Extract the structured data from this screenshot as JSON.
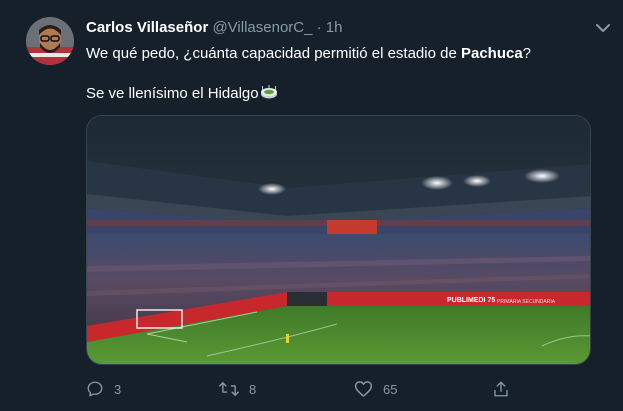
{
  "tweet": {
    "author_name": "Carlos Villaseñor",
    "author_handle": "@VillasenorC_",
    "separator": "·",
    "time": "1h",
    "text_part1": "We qué pedo, ¿cuánta capacidad permitió el estadio de ",
    "text_bold": "Pachuca",
    "text_part2": "?",
    "text_line2": "Se ve llenísimo el Hidalgo",
    "emoji_icon": "stadium-emoji-icon",
    "image_board_text": "PUBLIMEDI 75",
    "image_board_sub": "PRIMARIA SECUNDARIA"
  },
  "actions": {
    "replies": "3",
    "retweets": "8",
    "likes": "65"
  },
  "colors": {
    "background": "#15202b",
    "secondary_text": "#8899a6",
    "border": "#38444d",
    "pitch": "#4f8a2e",
    "ad_board": "#c8282c"
  },
  "icons": [
    "more-options-icon",
    "reply-icon",
    "retweet-icon",
    "like-icon",
    "share-icon"
  ]
}
